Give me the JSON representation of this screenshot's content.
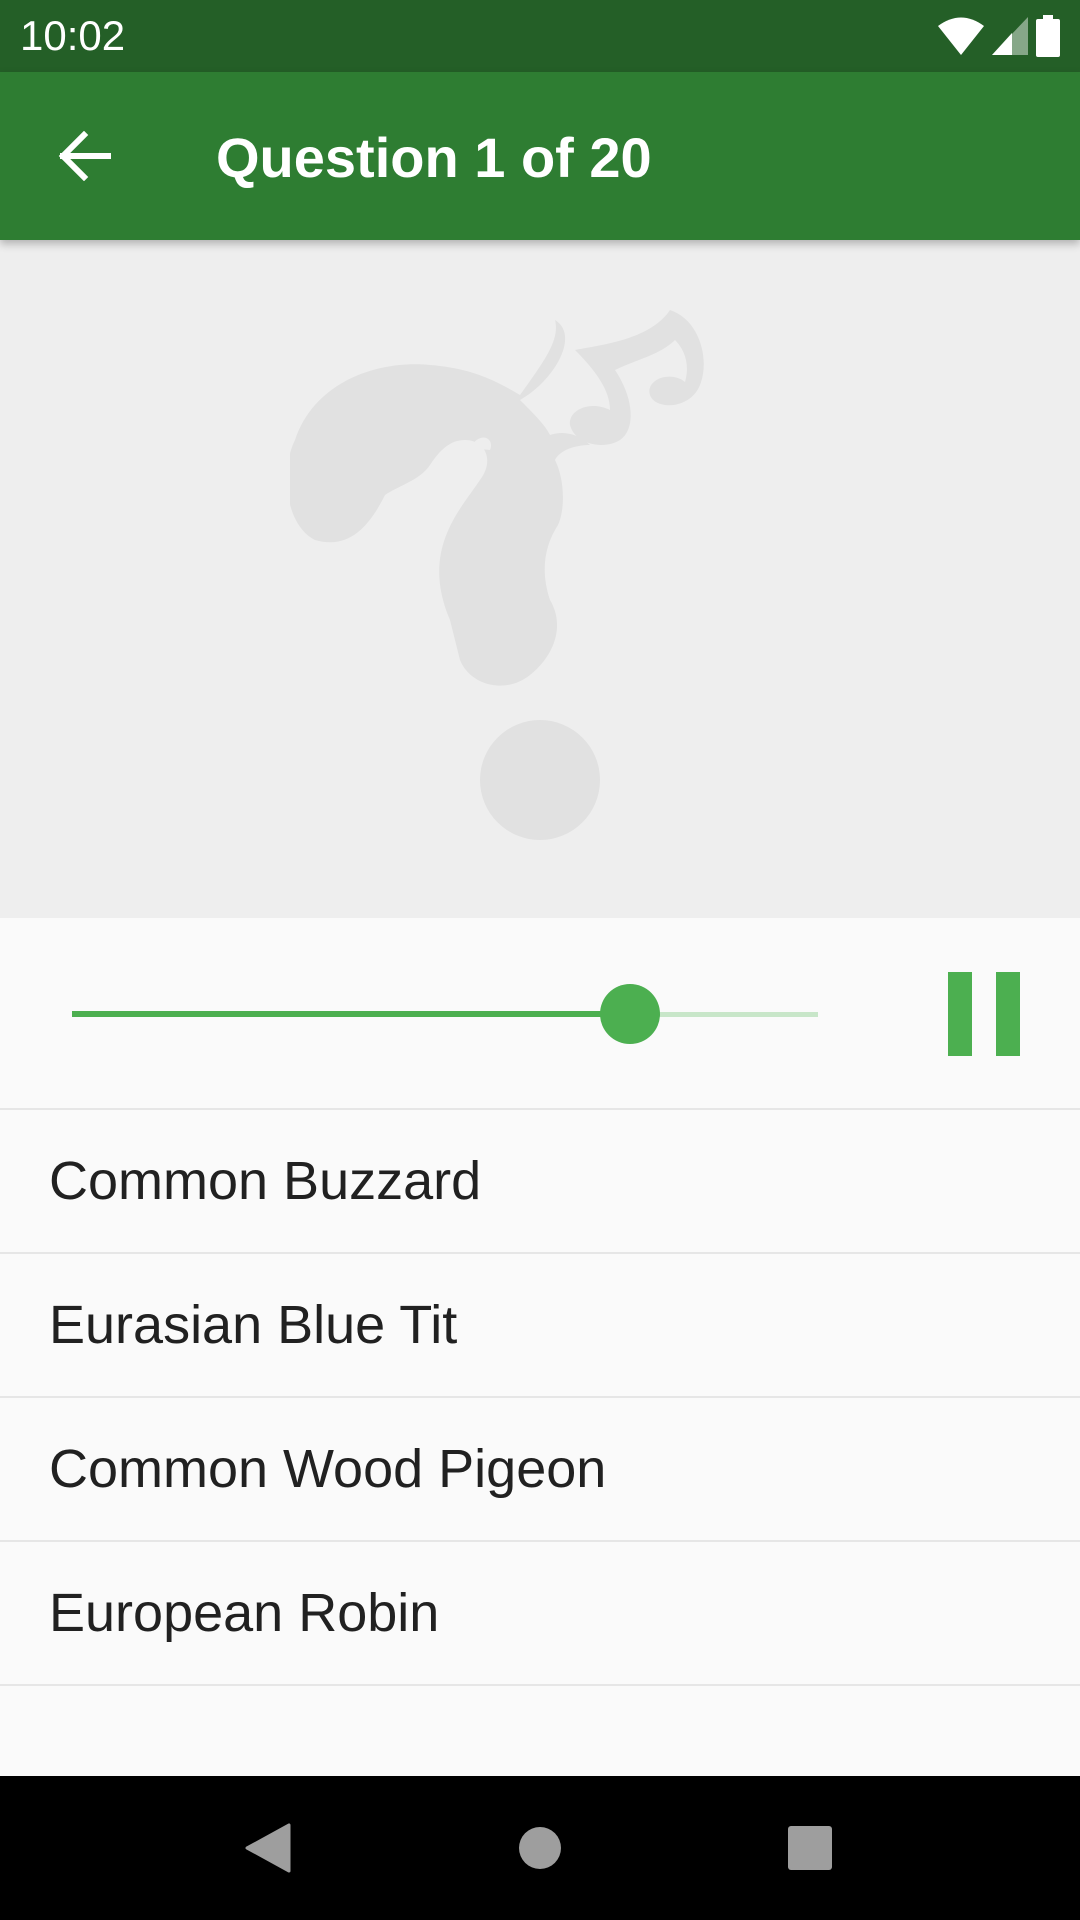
{
  "status_bar": {
    "time": "10:02",
    "icons": [
      "wifi-icon",
      "cell-signal-icon",
      "battery-icon"
    ]
  },
  "app_bar": {
    "title": "Question 1 of 20",
    "back_icon": "arrow-back-icon",
    "background": "#2e7d32"
  },
  "image": {
    "placeholder_icon": "mystery-bird-question-icon"
  },
  "player": {
    "progress": 0.748,
    "state_icon": "pause-icon",
    "accent": "#4caf50"
  },
  "answers": [
    {
      "label": "Common Buzzard"
    },
    {
      "label": "Eurasian Blue Tit"
    },
    {
      "label": "Common Wood Pigeon"
    },
    {
      "label": "European Robin"
    }
  ],
  "nav_bar": {
    "icons": [
      "back-triangle-icon",
      "home-circle-icon",
      "recents-square-icon"
    ]
  }
}
